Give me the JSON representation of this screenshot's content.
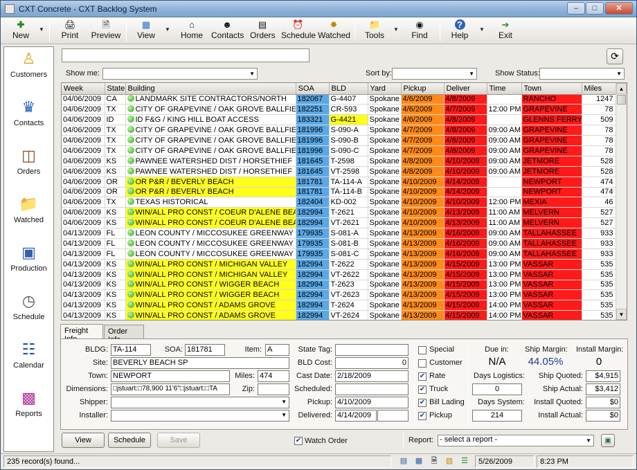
{
  "window": {
    "title": "CXT Concrete - CXT Backlog System"
  },
  "toolbar": {
    "new": "New",
    "print": "Print",
    "preview": "Preview",
    "view": "View",
    "home": "Home",
    "contacts": "Contacts",
    "orders": "Orders",
    "schedule": "Schedule",
    "watched": "Watched",
    "tools": "Tools",
    "find": "Find",
    "help": "Help",
    "exit": "Exit"
  },
  "nav": {
    "customers": "Customers",
    "contacts": "Contacts",
    "orders": "Orders",
    "watched": "Watched",
    "production": "Production",
    "schedule": "Schedule",
    "calendar": "Calendar",
    "reports": "Reports"
  },
  "filters": {
    "show_me_label": "Show me:",
    "show_me_value": "",
    "sort_by_label": "Sort by:",
    "sort_by_value": "",
    "show_status_label": "Show Status:",
    "show_status_value": "",
    "search_value": ""
  },
  "grid": {
    "columns": [
      "Week",
      "State",
      "Building",
      "SOA",
      "BLD",
      "Yard",
      "Pickup",
      "Deliver",
      "Time",
      "Town",
      "Miles"
    ],
    "rows": [
      {
        "week": "04/06/2009",
        "state": "CA",
        "building": "LANDMARK SITE CONTRACTORS/NORTH",
        "soa": "182067",
        "bld": "G-4407",
        "yard": "Spokane",
        "pickup": "4/6/2009",
        "deliver": "4/8/2009",
        "time": "",
        "town": "RANCHO",
        "miles": "1247",
        "bhl": false,
        "bldhl": false
      },
      {
        "week": "04/06/2009",
        "state": "TX",
        "building": "CITY OF GRAPEVINE / OAK GROVE BALLFIELD",
        "soa": "182251",
        "bld": "CR-593",
        "yard": "Spokane",
        "pickup": "4/6/2009",
        "deliver": "4/7/2009",
        "time": "12:00 PM",
        "town": "GRAPEVINE",
        "miles": "78",
        "bhl": false,
        "bldhl": false
      },
      {
        "week": "04/06/2009",
        "state": "ID",
        "building": "ID F&G / KING HILL BOAT ACCESS",
        "soa": "183321",
        "bld": "G-4421",
        "yard": "Spokane",
        "pickup": "4/6/2009",
        "deliver": "4/8/2009",
        "time": "",
        "town": "GLENNS FERRY",
        "miles": "509",
        "bhl": false,
        "bldhl": true
      },
      {
        "week": "04/06/2009",
        "state": "TX",
        "building": "CITY OF GRAPEVINE / OAK GROVE BALLFIELD",
        "soa": "181996",
        "bld": "S-090-A",
        "yard": "Spokane",
        "pickup": "4/7/2009",
        "deliver": "4/8/2009",
        "time": "09:00 AM",
        "town": "GRAPEVINE",
        "miles": "78",
        "bhl": false,
        "bldhl": false
      },
      {
        "week": "04/06/2009",
        "state": "TX",
        "building": "CITY OF GRAPEVINE / OAK GROVE BALLFIELD",
        "soa": "181996",
        "bld": "S-090-B",
        "yard": "Spokane",
        "pickup": "4/7/2009",
        "deliver": "4/8/2009",
        "time": "09:00 AM",
        "town": "GRAPEVINE",
        "miles": "78",
        "bhl": false,
        "bldhl": false
      },
      {
        "week": "04/06/2009",
        "state": "TX",
        "building": "CITY OF GRAPEVINE / OAK GROVE BALLFIELD",
        "soa": "181996",
        "bld": "S-090-C",
        "yard": "Spokane",
        "pickup": "4/7/2009",
        "deliver": "4/8/2009",
        "time": "09:00 AM",
        "town": "GRAPEVINE",
        "miles": "78",
        "bhl": false,
        "bldhl": false
      },
      {
        "week": "04/06/2009",
        "state": "KS",
        "building": "PAWNEE WATERSHED DIST / HORSETHIEF",
        "soa": "181645",
        "bld": "T-2598",
        "yard": "Spokane",
        "pickup": "4/8/2009",
        "deliver": "4/10/2009",
        "time": "09:00 AM",
        "town": "JETMORE",
        "miles": "528",
        "bhl": false,
        "bldhl": false
      },
      {
        "week": "04/06/2009",
        "state": "KS",
        "building": "PAWNEE WATERSHED DIST / HORSETHIEF",
        "soa": "181645",
        "bld": "VT-2598",
        "yard": "Spokane",
        "pickup": "4/8/2009",
        "deliver": "4/10/2009",
        "time": "09:00 AM",
        "town": "JETMORE",
        "miles": "528",
        "bhl": false,
        "bldhl": false
      },
      {
        "week": "04/06/2009",
        "state": "OR",
        "building": "OR P&R / BEVERLY BEACH",
        "soa": "181781",
        "bld": "TA-114-A",
        "yard": "Spokane",
        "pickup": "4/10/2009",
        "deliver": "4/14/2009",
        "time": "",
        "town": "NEWPORT",
        "miles": "474",
        "bhl": true,
        "bldhl": false
      },
      {
        "week": "04/06/2009",
        "state": "OR",
        "building": "OR P&R / BEVERLY BEACH",
        "soa": "181781",
        "bld": "TA-114-B",
        "yard": "Spokane",
        "pickup": "4/10/2009",
        "deliver": "4/14/2009",
        "time": "",
        "town": "NEWPORT",
        "miles": "474",
        "bhl": true,
        "bldhl": false
      },
      {
        "week": "04/06/2009",
        "state": "TX",
        "building": "TEXAS HISTORICAL",
        "soa": "182404",
        "bld": "KD-002",
        "yard": "Spokane",
        "pickup": "4/10/2009",
        "deliver": "4/10/2009",
        "time": "12:00 PM",
        "town": "MEXIA",
        "miles": "46",
        "bhl": false,
        "bldhl": false
      },
      {
        "week": "04/06/2009",
        "state": "KS",
        "building": "WIN/ALL PRO CONST / COEUR D'ALENE BEACH",
        "soa": "182994",
        "bld": "T-2621",
        "yard": "Spokane",
        "pickup": "4/10/2009",
        "deliver": "4/13/2009",
        "time": "11:00 AM",
        "town": "MELVERN",
        "miles": "527",
        "bhl": true,
        "bldhl": false
      },
      {
        "week": "04/06/2009",
        "state": "KS",
        "building": "WIN/ALL PRO CONST / COEUR D'ALENE BEACH",
        "soa": "182994",
        "bld": "VT-2621",
        "yard": "Spokane",
        "pickup": "4/10/2009",
        "deliver": "4/13/2009",
        "time": "11:00 AM",
        "town": "MELVERN",
        "miles": "527",
        "bhl": true,
        "bldhl": false
      },
      {
        "week": "04/13/2009",
        "state": "FL",
        "building": "LEON COUNTY / MICCOSUKEE GREENWAY",
        "soa": "179935",
        "bld": "S-081-A",
        "yard": "Spokane",
        "pickup": "4/13/2009",
        "deliver": "4/16/2009",
        "time": "09:00 AM",
        "town": "TALLAHASSEE",
        "miles": "933",
        "bhl": false,
        "bldhl": false
      },
      {
        "week": "04/13/2009",
        "state": "FL",
        "building": "LEON COUNTY / MICCOSUKEE GREENWAY",
        "soa": "179935",
        "bld": "S-081-B",
        "yard": "Spokane",
        "pickup": "4/13/2009",
        "deliver": "4/16/2009",
        "time": "09:00 AM",
        "town": "TALLAHASSEE",
        "miles": "933",
        "bhl": false,
        "bldhl": false
      },
      {
        "week": "04/13/2009",
        "state": "FL",
        "building": "LEON COUNTY / MICCOSUKEE GREENWAY",
        "soa": "179935",
        "bld": "S-081-C",
        "yard": "Spokane",
        "pickup": "4/13/2009",
        "deliver": "4/16/2009",
        "time": "09:00 AM",
        "town": "TALLAHASSEE",
        "miles": "933",
        "bhl": false,
        "bldhl": false
      },
      {
        "week": "04/13/2009",
        "state": "KS",
        "building": "WIN/ALL PRO CONST / MICHIGAN VALLEY",
        "soa": "182994",
        "bld": "T-2622",
        "yard": "Spokane",
        "pickup": "4/13/2009",
        "deliver": "4/15/2009",
        "time": "13:00 PM",
        "town": "VASSAR",
        "miles": "535",
        "bhl": true,
        "bldhl": false
      },
      {
        "week": "04/13/2009",
        "state": "KS",
        "building": "WIN/ALL PRO CONST / MICHIGAN VALLEY",
        "soa": "182994",
        "bld": "VT-2622",
        "yard": "Spokane",
        "pickup": "4/13/2009",
        "deliver": "4/15/2009",
        "time": "13:00 PM",
        "town": "VASSAR",
        "miles": "535",
        "bhl": true,
        "bldhl": false
      },
      {
        "week": "04/13/2009",
        "state": "KS",
        "building": "WIN/ALL PRO CONST / WIGGER BEACH",
        "soa": "182994",
        "bld": "T-2623",
        "yard": "Spokane",
        "pickup": "4/13/2009",
        "deliver": "4/15/2009",
        "time": "13:00 PM",
        "town": "VASSAR",
        "miles": "535",
        "bhl": true,
        "bldhl": false
      },
      {
        "week": "04/13/2009",
        "state": "KS",
        "building": "WIN/ALL PRO CONST / WIGGER BEACH",
        "soa": "182994",
        "bld": "VT-2623",
        "yard": "Spokane",
        "pickup": "4/13/2009",
        "deliver": "4/15/2009",
        "time": "13:00 PM",
        "town": "VASSAR",
        "miles": "535",
        "bhl": true,
        "bldhl": false
      },
      {
        "week": "04/13/2009",
        "state": "KS",
        "building": "WIN/ALL PRO CONST / ADAMS GROVE",
        "soa": "182994",
        "bld": "T-2624",
        "yard": "Spokane",
        "pickup": "4/13/2009",
        "deliver": "4/15/2009",
        "time": "14:00 PM",
        "town": "VASSAR",
        "miles": "535",
        "bhl": true,
        "bldhl": false
      },
      {
        "week": "04/13/2009",
        "state": "KS",
        "building": "WIN/ALL PRO CONST / ADAMS GROVE",
        "soa": "182994",
        "bld": "VT-2624",
        "yard": "Spokane",
        "pickup": "4/13/2009",
        "deliver": "4/15/2009",
        "time": "14:00 PM",
        "town": "VASSAR",
        "miles": "535",
        "bhl": true,
        "bldhl": false
      }
    ]
  },
  "tabs": {
    "freight": "Freight Info",
    "order": "Order Info"
  },
  "freight": {
    "bldg_label": "BLDG:",
    "bldg": "TA-114",
    "soa_label": "SOA:",
    "soa": "181781",
    "item_label": "Item:",
    "item": "A",
    "site_label": "Site:",
    "site": "BEVERLY BEACH SP",
    "town_label": "Town:",
    "town": "NEWPORT",
    "miles_label": "Miles:",
    "miles": "474",
    "dimensions_label": "Dimensions:",
    "dimensions": "□jstuart:□78,900 11'6\"□jstuart:□TA",
    "zip_label": "Zip:",
    "zip": "",
    "shipper_label": "Shipper:",
    "shipper": "",
    "installer_label": "Installer:",
    "installer": "",
    "state_tag_label": "State Tag:",
    "state_tag": "",
    "bld_cost_label": "BLD Cost:",
    "bld_cost": "0",
    "cast_date_label": "Cast Date:",
    "cast_date": "2/18/2009",
    "scheduled_label": "Scheduled:",
    "scheduled": "",
    "pickup_label": "Pickup:",
    "pickup": "4/10/2009",
    "delivered_label": "Delivered:",
    "delivered": "4/14/2009",
    "delivered2": ""
  },
  "checks": {
    "special": {
      "label": "Special",
      "checked": false
    },
    "customer": {
      "label": "Customer",
      "checked": false
    },
    "rate": {
      "label": "Rate",
      "checked": true
    },
    "truck": {
      "label": "Truck",
      "checked": true
    },
    "bill_lading": {
      "label": "Bill Lading",
      "checked": true
    },
    "pickup": {
      "label": "Pickup",
      "checked": true
    }
  },
  "summary": {
    "due_in_label": "Due in:",
    "due_in": "N/A",
    "ship_margin_label": "Ship Margin:",
    "ship_margin": "44.05%",
    "install_margin_label": "Install Margin:",
    "install_margin": "0",
    "days_logistics_label": "Days Logistics:",
    "days_logistics": "0",
    "days_system_label": "Days System:",
    "days_system": "214",
    "ship_quoted_label": "Ship Quoted:",
    "ship_quoted": "$4,915",
    "ship_actual_label": "Ship Actual:",
    "ship_actual": "$3,412",
    "install_quoted_label": "Install Quoted:",
    "install_quoted": "$0",
    "install_actual_label": "Install Actual:",
    "install_actual": "$0",
    "accent_color": "#1b3c8f"
  },
  "actions": {
    "view": "View",
    "schedule": "Schedule",
    "save": "Save",
    "watch_order": "Watch Order",
    "watch_order_checked": true,
    "report_label": "Report:",
    "report_placeholder": "- select a report -"
  },
  "status": {
    "records": "235 record(s) found...",
    "date": "5/26/2009",
    "time": "8:23 PM"
  },
  "colors": {
    "soa": "#5aa8e6",
    "highlight": "#ffff1a",
    "pickup": "#ff8a1a",
    "deliver_town": "#ff1a1a"
  }
}
